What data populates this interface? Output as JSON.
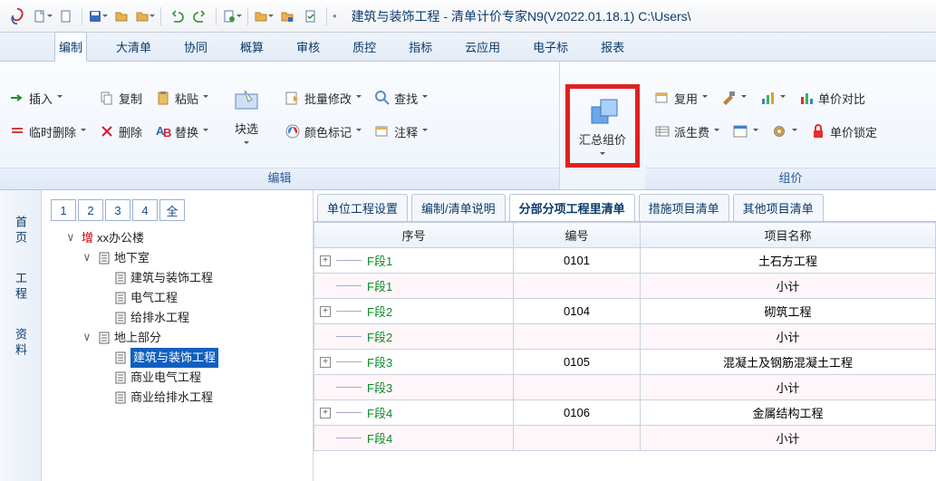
{
  "title": "建筑与装饰工程 - 清单计价专家N9(V2022.01.18.1) C:\\Users\\",
  "tabs": [
    "编制",
    "大清单",
    "协同",
    "概算",
    "审核",
    "质控",
    "指标",
    "云应用",
    "电子标",
    "报表"
  ],
  "active_tab_index": 0,
  "ribbon": {
    "group_edit_label": "编辑",
    "group_price_label": "组价",
    "insert": "插入",
    "copy": "复制",
    "paste": "粘贴",
    "tempdel": "临时删除",
    "delete": "删除",
    "replace": "替换",
    "blocksel": "块选",
    "batchmod": "批量修改",
    "find": "查找",
    "colormark": "颜色标记",
    "annotate": "注释",
    "summary": "汇总组价",
    "reuse": "复用",
    "dispatch": "派生费",
    "unitcompare": "单价对比",
    "unitlock": "单价锁定"
  },
  "sidebar": [
    "首页",
    "工程",
    "资料"
  ],
  "pagebtns": [
    "1",
    "2",
    "3",
    "4",
    "全"
  ],
  "tree": {
    "root_prefix": "增",
    "root": "xx办公楼",
    "n1": "地下室",
    "n1a": "建筑与装饰工程",
    "n1b": "电气工程",
    "n1c": "给排水工程",
    "n2": "地上部分",
    "n2a": "建筑与装饰工程",
    "n2b": "商业电气工程",
    "n2c": "商业给排水工程"
  },
  "subtabs": [
    "单位工程设置",
    "编制/清单说明",
    "分部分项工程里清单",
    "措施项目清单",
    "其他项目清单"
  ],
  "active_subtab_index": 2,
  "grid_headers": {
    "seq": "序号",
    "code": "编号",
    "name": "项目名称"
  },
  "rows": [
    {
      "seq": "F段1",
      "code": "0101",
      "name": "土石方工程",
      "exp": true
    },
    {
      "seq": "F段1",
      "code": "",
      "name": "小计",
      "sub": true
    },
    {
      "seq": "F段2",
      "code": "0104",
      "name": "砌筑工程",
      "exp": true
    },
    {
      "seq": "F段2",
      "code": "",
      "name": "小计",
      "sub": true
    },
    {
      "seq": "F段3",
      "code": "0105",
      "name": "混凝土及钢筋混凝土工程",
      "exp": true
    },
    {
      "seq": "F段3",
      "code": "",
      "name": "小计",
      "sub": true
    },
    {
      "seq": "F段4",
      "code": "0106",
      "name": "金属结构工程",
      "exp": true
    },
    {
      "seq": "F段4",
      "code": "",
      "name": "小计",
      "sub": true
    }
  ]
}
